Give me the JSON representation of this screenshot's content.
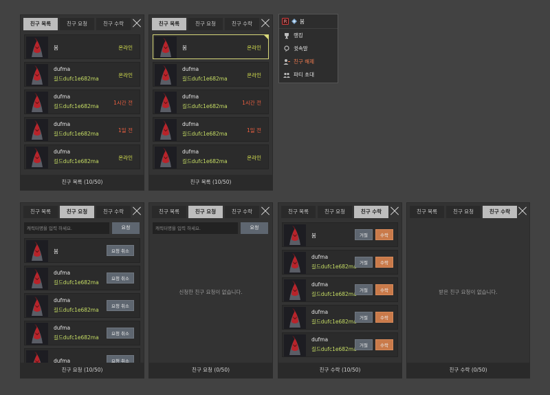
{
  "tabs": {
    "list": "친구 목록",
    "request": "친구 요청",
    "accept": "친구 수락"
  },
  "friend_rows": [
    {
      "name": "봄",
      "guild": "",
      "status": "온라인",
      "state": "on"
    },
    {
      "name": "dufma",
      "guild": "길드dufc1e682ma",
      "status": "온라인",
      "state": "on"
    },
    {
      "name": "dufma",
      "guild": "길드dufc1e682ma",
      "status": "1시간 전",
      "state": "off"
    },
    {
      "name": "dufma",
      "guild": "길드dufc1e682ma",
      "status": "1일 전",
      "state": "off"
    },
    {
      "name": "dufma",
      "guild": "길드dufc1e682ma",
      "status": "온라인",
      "state": "on"
    }
  ],
  "request_rows": [
    {
      "name": "봄",
      "guild": ""
    },
    {
      "name": "dufma",
      "guild": "길드dufc1e682ma"
    },
    {
      "name": "dufma",
      "guild": "길드dufc1e682ma"
    },
    {
      "name": "dufma",
      "guild": "길드dufc1e682ma"
    },
    {
      "name": "dufma",
      "guild": ""
    }
  ],
  "accept_rows": [
    {
      "name": "봄",
      "guild": ""
    },
    {
      "name": "dufma",
      "guild": "길드dufc1e682ma"
    },
    {
      "name": "dufma",
      "guild": "길드dufc1e682ma"
    },
    {
      "name": "dufma",
      "guild": "길드dufc1e682ma"
    },
    {
      "name": "dufma",
      "guild": "길드dufc1e682ma"
    }
  ],
  "footers": {
    "list": "친구 목록 (10/50)",
    "request_full": "친구 요청 (10/50)",
    "request_empty": "친구 요청 (0/50)",
    "accept_full": "친구 수락 (10/50)",
    "accept_empty": "친구 수락 (0/50)"
  },
  "search": {
    "placeholder": "캐릭터명을 입력 하세요.",
    "button": "요청"
  },
  "buttons": {
    "cancel_request": "요청 취소",
    "reject": "거절",
    "accept": "수락"
  },
  "empty": {
    "request": "신청한 친구 요청이 없습니다.",
    "accept": "받은 친구 요청이 없습니다."
  },
  "context_menu": {
    "name": "봄",
    "items": [
      {
        "label": "랭킹",
        "icon": "trophy-icon"
      },
      {
        "label": "귓속말",
        "icon": "whisper-icon"
      },
      {
        "label": "친구 해제",
        "icon": "remove-friend-icon"
      },
      {
        "label": "파티 초대",
        "icon": "party-icon"
      }
    ]
  },
  "colors": {
    "online": "#d7e24f",
    "offline": "#f06040",
    "guild": "#c6dd64",
    "accept_button": "#c97a4a",
    "danger": "#f27c4f"
  }
}
